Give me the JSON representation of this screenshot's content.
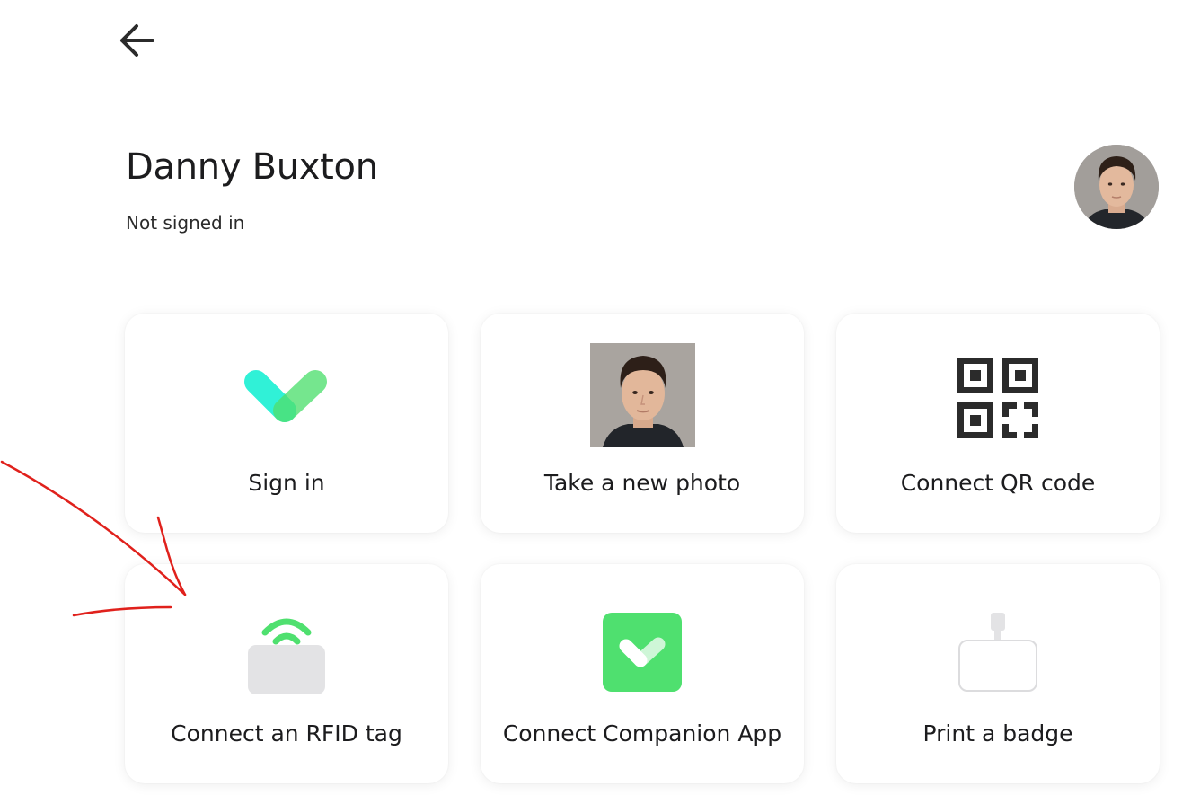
{
  "header": {
    "back_icon": "arrow-left-icon"
  },
  "profile": {
    "name": "Danny Buxton",
    "status": "Not signed in",
    "avatar_icon": "user-avatar"
  },
  "actions": [
    {
      "label": "Sign in",
      "icon": "checkmark-logo-icon"
    },
    {
      "label": "Take a new photo",
      "icon": "user-photo"
    },
    {
      "label": "Connect QR code",
      "icon": "qr-code-icon"
    },
    {
      "label": "Connect an RFID tag",
      "icon": "rfid-tag-icon"
    },
    {
      "label": "Connect Companion App",
      "icon": "companion-app-icon"
    },
    {
      "label": "Print a badge",
      "icon": "badge-icon"
    }
  ],
  "colors": {
    "teal": "#1ff0d4",
    "green": "#4fe06f",
    "annotation_red": "#e0211c"
  }
}
